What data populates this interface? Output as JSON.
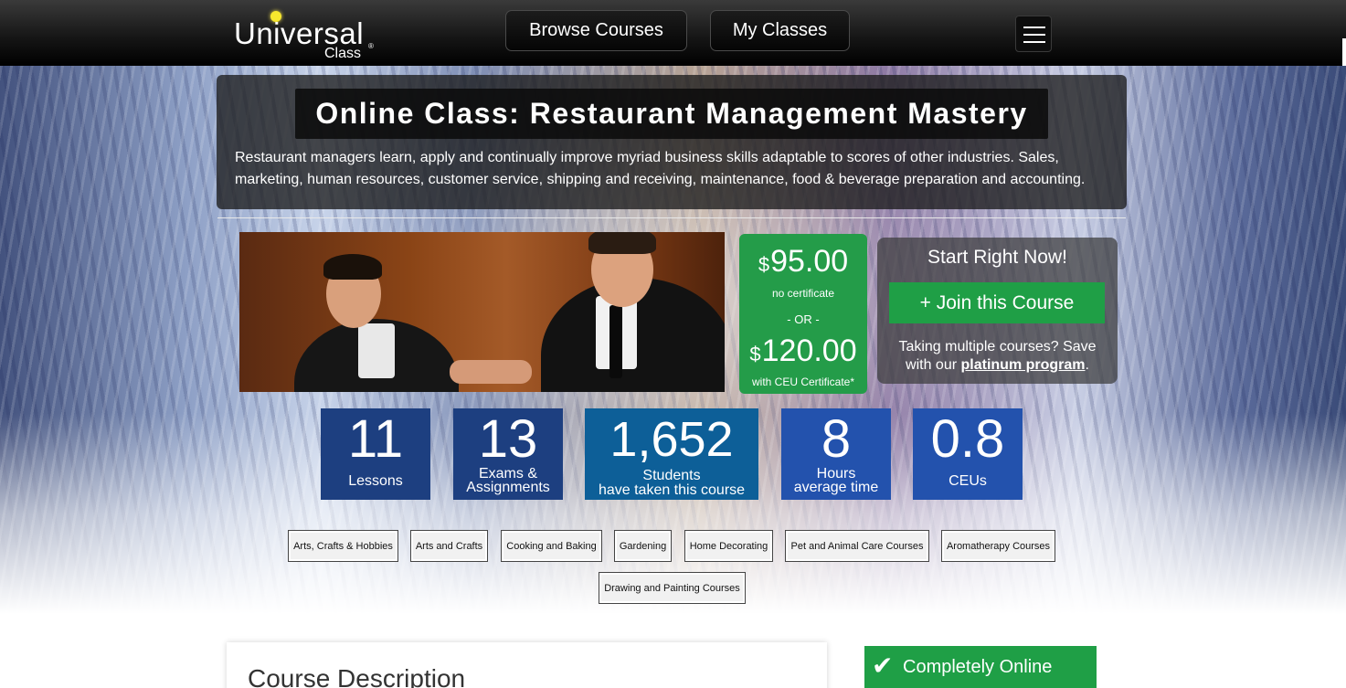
{
  "header": {
    "logo_text": "Universal",
    "logo_sub": "Class",
    "logo_reg": "®",
    "nav": {
      "browse": "Browse Courses",
      "my_classes": "My Classes"
    }
  },
  "hero": {
    "title": "Online Class: Restaurant Management Mastery",
    "subtitle": "Restaurant managers learn, apply and continually improve myriad business skills adaptable to scores of other industries. Sales, marketing, human resources, customer service, shipping and receiving, maintenance, food & beverage preparation and accounting."
  },
  "pricing": {
    "currency": "$",
    "price_a": "95.00",
    "note_a": "no certificate",
    "or": "- OR -",
    "price_b": "120.00",
    "note_b": "with CEU Certificate*"
  },
  "start": {
    "title": "Start Right Now!",
    "join": "+ Join this Course",
    "note_a": "Taking multiple courses? Save",
    "note_b": "with our",
    "link": "platinum program",
    "end": "."
  },
  "stats": {
    "lessons": {
      "num": "11",
      "label": "Lessons"
    },
    "exams": {
      "num": "13",
      "label_a": "Exams &",
      "label_b": "Assignments"
    },
    "students": {
      "num": "1,652",
      "label": "Students",
      "sub": "have taken this course"
    },
    "hours": {
      "num": "8",
      "label_a": "Hours",
      "label_b": "average time"
    },
    "ceus": {
      "num": "0.8",
      "label": "CEUs"
    }
  },
  "categories": [
    "Arts, Crafts & Hobbies",
    "Arts and Crafts",
    "Cooking and Baking",
    "Gardening",
    "Home Decorating",
    "Pet and Animal Care Courses",
    "Aromatherapy Courses",
    "Drawing and Painting Courses"
  ],
  "content": {
    "desc_title": "Course Description",
    "online": "Completely Online",
    "check": "✔"
  },
  "colors": {
    "green": "#249c49",
    "stat_navy": "#1d3f80",
    "stat_teal": "#0d5f98",
    "stat_blue": "#2352ad"
  }
}
